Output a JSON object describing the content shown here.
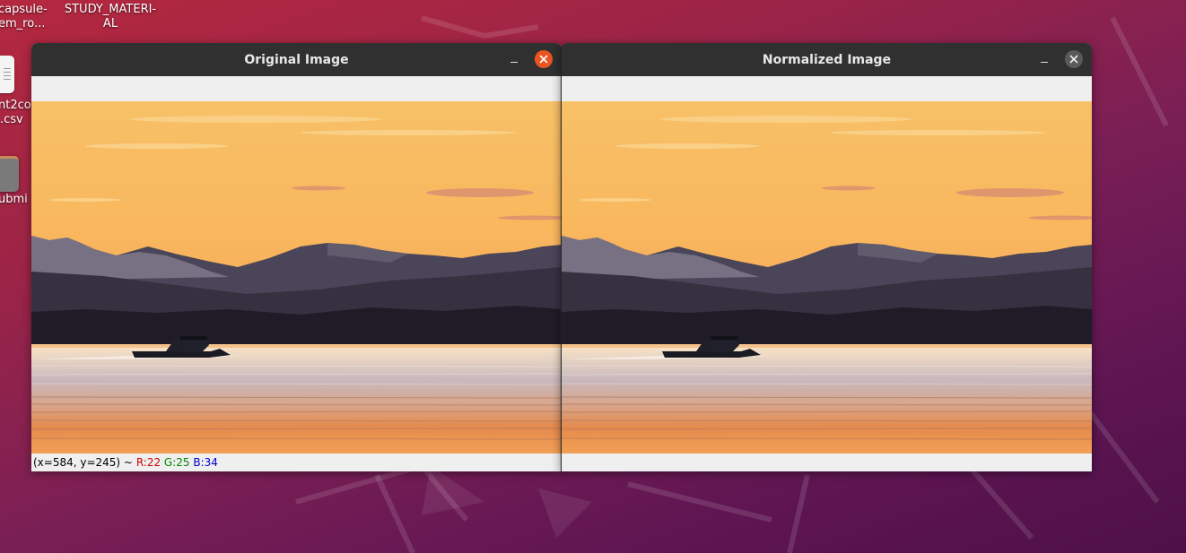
{
  "desktop": {
    "icons": [
      {
        "label_line1": "capsule-",
        "label_line2": "em_ro..."
      },
      {
        "label_line1": "STUDY_MATERI-",
        "label_line2": "AL"
      },
      {
        "label_line1": "nt2co",
        "label_line2": ".csv"
      },
      {
        "label_line1": "ubmi",
        "label_line2": ""
      }
    ]
  },
  "windows": {
    "original": {
      "title": "Original Image",
      "status": {
        "coords": "(x=584, y=245) ~",
        "r": "R:22",
        "g": "G:25",
        "b": "B:34"
      }
    },
    "normalized": {
      "title": "Normalized Image"
    }
  },
  "colors": {
    "close_active": "#e95420",
    "close_inactive": "#5a5a5a",
    "titlebar": "#303030"
  }
}
